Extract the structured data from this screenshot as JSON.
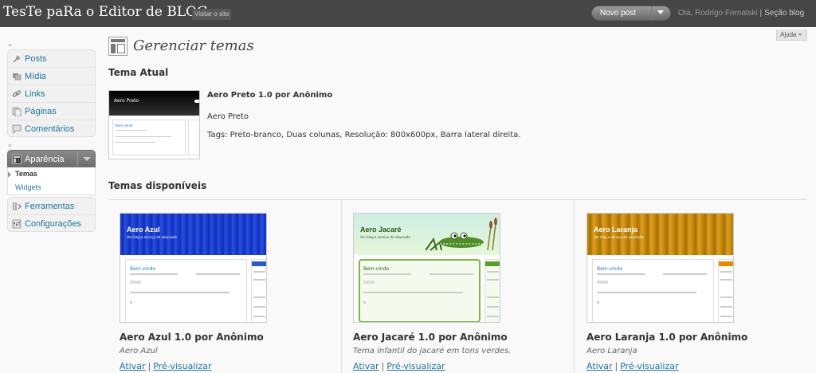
{
  "header": {
    "site_title": "TesTe paRa o Editor de BLOGs",
    "visit_site": "Visitar o site",
    "favorite_action": "Novo post",
    "greeting": "Olá, Rodrigo Fornalski",
    "separator": "|",
    "logout": "Seção blog"
  },
  "help": {
    "label": "Ajuda"
  },
  "sidebar": {
    "collapse_glyph": "«",
    "top_items": [
      {
        "label": "Posts",
        "icon": "pin-icon"
      },
      {
        "label": "Mídia",
        "icon": "media-icon"
      },
      {
        "label": "Links",
        "icon": "link-icon"
      },
      {
        "label": "Páginas",
        "icon": "pages-icon"
      },
      {
        "label": "Comentários",
        "icon": "comment-icon"
      }
    ],
    "appearance": {
      "label": "Aparência",
      "icon": "appearance-icon",
      "submenu": [
        {
          "label": "Temas",
          "current": true
        },
        {
          "label": "Widgets",
          "current": false
        }
      ]
    },
    "bottom_items": [
      {
        "label": "Ferramentas",
        "icon": "tools-icon"
      },
      {
        "label": "Configurações",
        "icon": "settings-icon"
      }
    ]
  },
  "page": {
    "title": "Gerenciar temas",
    "icon": "themes-page-icon"
  },
  "current_theme": {
    "heading": "Tema Atual",
    "name": "Aero Preto 1.0 por Anônimo",
    "description": "Aero Preto",
    "tags": "Tags: Preto-branco, Duas colunas, Resolução: 800x600px, Barra lateral direita.",
    "screenshot": {
      "header_text": "Aero Preto",
      "post_title": "Bem-vindo",
      "header_color": "#111111"
    }
  },
  "available": {
    "heading": "Temas disponíveis",
    "themes": [
      {
        "title": "Aero Azul 1.0 por Anônimo",
        "description": "Aero Azul",
        "activate": "Ativar",
        "preview": "Pré-visualizar",
        "screenshot": {
          "header_text": "Aero Azul",
          "subtitle": "Um blog a serviço da educação",
          "post_title": "Bem-vindo",
          "header_color": "#1a3fd1",
          "accent": "#2a59c9"
        }
      },
      {
        "title": "Aero Jacaré 1.0 por Anônimo",
        "description": "Tema infantil do jacaré em tons verdes.",
        "activate": "Ativar",
        "preview": "Pré-visualizar",
        "screenshot": {
          "header_text": "Aero Jacaré",
          "subtitle": "Um blog a serviço da educação",
          "post_title": "Bem-vindo",
          "header_color": "#d7efe3",
          "accent": "#5a9e2a"
        }
      },
      {
        "title": "Aero Laranja 1.0 por Anônimo",
        "description": "Aero Laranja",
        "activate": "Ativar",
        "preview": "Pré-visualizar",
        "screenshot": {
          "header_text": "Aero Laranja",
          "subtitle": "Um blog a serviço da educação",
          "post_title": "Bem-vindo",
          "header_color": "#c98a0a",
          "accent": "#e68a00"
        }
      }
    ]
  },
  "colors": {
    "header_bg": "#464646",
    "link": "#21759b",
    "appearance_menu": "#7a7a7a"
  }
}
